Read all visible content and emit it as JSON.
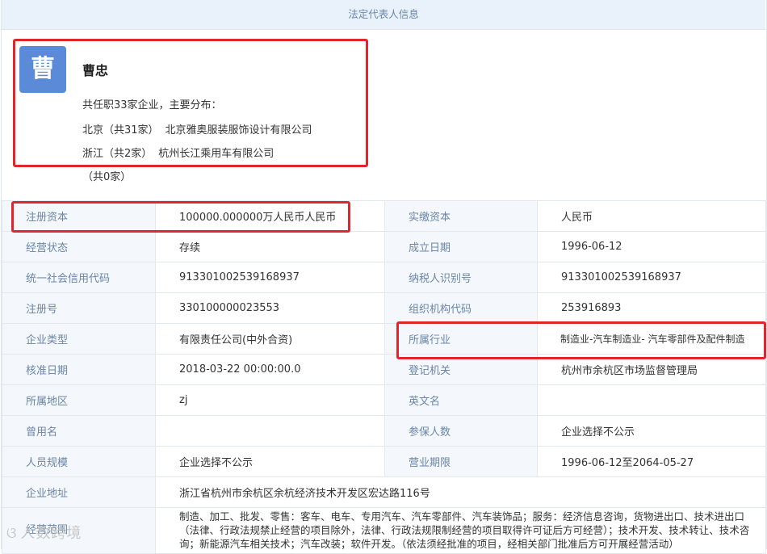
{
  "section": {
    "title": "法定代表人信息"
  },
  "person": {
    "avatar_char": "曹",
    "name": "曹忠",
    "summary": "共任职33家企业，主要分布：",
    "regions": [
      {
        "region": "北京（共31家）",
        "company": "北京雅奥服装服饰设计有限公司"
      },
      {
        "region": "浙江（共2家）",
        "company": "杭州长江乘用车有限公司"
      },
      {
        "region": "（共0家）",
        "company": ""
      }
    ]
  },
  "info_rows": [
    {
      "l1": "注册资本",
      "v1": "100000.000000万人民币人民币",
      "l2": "实缴资本",
      "v2": "人民币"
    },
    {
      "l1": "经营状态",
      "v1": "存续",
      "l2": "成立日期",
      "v2": "1996-06-12"
    },
    {
      "l1": "统一社会信用代码",
      "v1": "913301002539168937",
      "l2": "纳税人识别号",
      "v2": "913301002539168937"
    },
    {
      "l1": "注册号",
      "v1": "330100000023553",
      "l2": "组织机构代码",
      "v2": "253916893"
    },
    {
      "l1": "企业类型",
      "v1": "有限责任公司(中外合资)",
      "l2": "所属行业",
      "v2": "制造业-汽车制造业- 汽车零部件及配件制造"
    },
    {
      "l1": "核准日期",
      "v1": "2018-03-22 00:00:00.0",
      "l2": "登记机关",
      "v2": "杭州市余杭区市场监督管理局"
    },
    {
      "l1": "所属地区",
      "v1": "zj",
      "l2": "英文名",
      "v2": ""
    },
    {
      "l1": "曾用名",
      "v1": "",
      "l2": "参保人数",
      "v2": "企业选择不公示"
    },
    {
      "l1": "人员规模",
      "v1": "企业选择不公示",
      "l2": "营业期限",
      "v2": "1996-06-12至2064-05-27"
    }
  ],
  "address": {
    "label": "企业地址",
    "value": "浙江省杭州市余杭区余杭经济技术开发区宏达路116号"
  },
  "scope": {
    "label": "经营范围",
    "value": "制造、加工、批发、零售：客车、电车、专用汽车、汽车零部件、汽车装饰品；服务：经济信息咨询，货物进出口、技术进出口（法律、行政法规禁止经营的项目除外，法律、行政法规限制经营的项目取得许可证后方可经营）；技术开发、技术转让、技术咨询；新能源汽车相关技术；汽车改装；软件开发。（依法须经批准的项目，经相关部门批准后方可开展经营活动）"
  },
  "watermark": {
    "text": "人数跨境"
  },
  "colors": {
    "highlight": "#e0262b",
    "header_bg": "#e9f1fa",
    "label_text": "#6a86a9",
    "avatar_bg": "#5b8ad8"
  }
}
